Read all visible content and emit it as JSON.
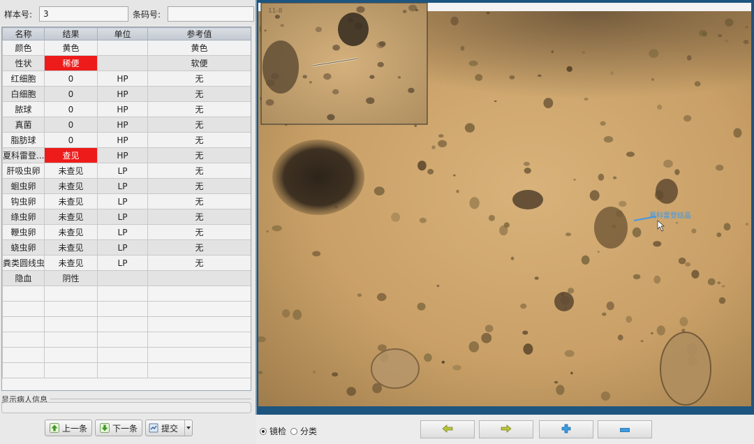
{
  "header": {
    "sample_label": "样本号:",
    "sample_value": "3",
    "barcode_label": "条码号:",
    "barcode_value": ""
  },
  "table": {
    "columns": [
      "名称",
      "结果",
      "单位",
      "参考值"
    ],
    "rows": [
      {
        "name": "颜色",
        "result": "黄色",
        "unit": "",
        "ref": "黄色",
        "flag": false
      },
      {
        "name": "性状",
        "result": "稀便",
        "unit": "",
        "ref": "软便",
        "flag": true
      },
      {
        "name": "红细胞",
        "result": "0",
        "unit": "HP",
        "ref": "无",
        "flag": false
      },
      {
        "name": "白细胞",
        "result": "0",
        "unit": "HP",
        "ref": "无",
        "flag": false
      },
      {
        "name": "脓球",
        "result": "0",
        "unit": "HP",
        "ref": "无",
        "flag": false
      },
      {
        "name": "真菌",
        "result": "0",
        "unit": "HP",
        "ref": "无",
        "flag": false
      },
      {
        "name": "脂肪球",
        "result": "0",
        "unit": "HP",
        "ref": "无",
        "flag": false
      },
      {
        "name": "夏科雷登...",
        "result": "查见",
        "unit": "HP",
        "ref": "无",
        "flag": true
      },
      {
        "name": "肝吸虫卵",
        "result": "未查见",
        "unit": "LP",
        "ref": "无",
        "flag": false
      },
      {
        "name": "蛔虫卵",
        "result": "未查见",
        "unit": "LP",
        "ref": "无",
        "flag": false
      },
      {
        "name": "钩虫卵",
        "result": "未查见",
        "unit": "LP",
        "ref": "无",
        "flag": false
      },
      {
        "name": "绦虫卵",
        "result": "未查见",
        "unit": "LP",
        "ref": "无",
        "flag": false
      },
      {
        "name": "鞭虫卵",
        "result": "未查见",
        "unit": "LP",
        "ref": "无",
        "flag": false
      },
      {
        "name": "蛲虫卵",
        "result": "未查见",
        "unit": "LP",
        "ref": "无",
        "flag": false
      },
      {
        "name": "粪类圆线虫",
        "result": "未查见",
        "unit": "LP",
        "ref": "无",
        "flag": false
      },
      {
        "name": "隐血",
        "result": "阴性",
        "unit": "",
        "ref": "",
        "flag": false
      }
    ]
  },
  "patient_info": {
    "label": "显示病人信息"
  },
  "buttons": {
    "prev_label": "上一条",
    "next_label": "下一条",
    "submit_label": "提交"
  },
  "view_modes": {
    "option1": "镜检",
    "option2": "分类",
    "selected": "镜检"
  },
  "image": {
    "inset_label": "11-8",
    "annotation_label": "夏科雷登结晶",
    "tools": [
      "arrow-left-icon",
      "arrow-right-icon",
      "zoom-in-icon",
      "zoom-out-icon"
    ]
  },
  "colors": {
    "flag": "#ee1b1b",
    "accent": "#1d557f"
  }
}
